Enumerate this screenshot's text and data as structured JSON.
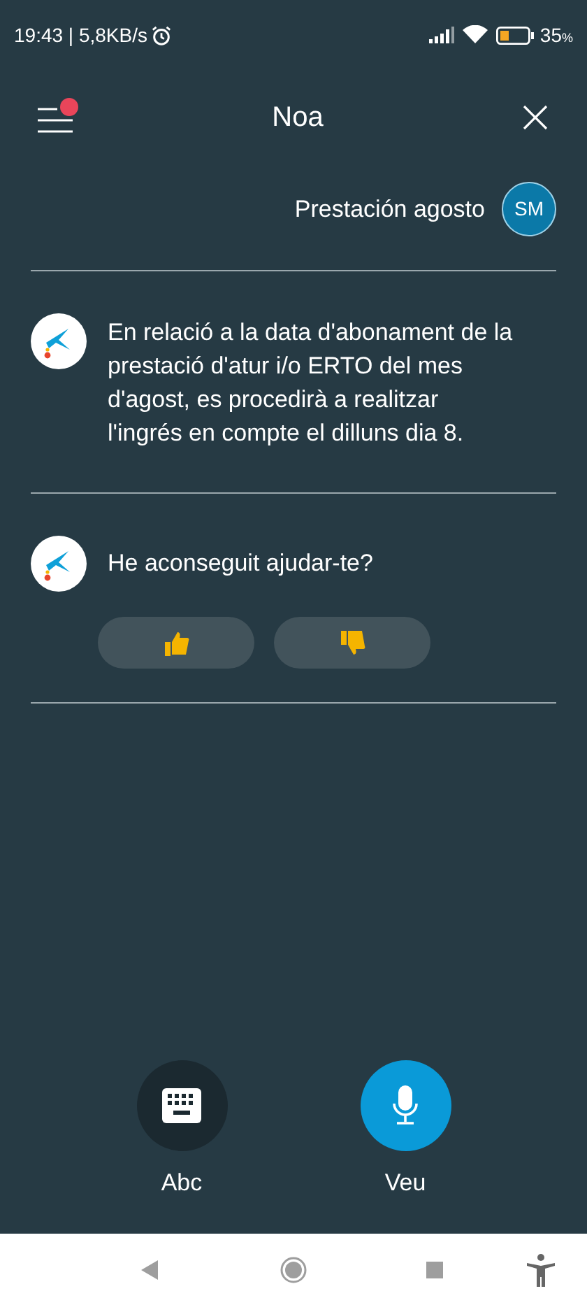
{
  "status_bar": {
    "text": "19:43 | 5,8KB/s",
    "battery": "35",
    "battery_unit": "%"
  },
  "header": {
    "title": "Noa",
    "menu_badge": true
  },
  "messages": [
    {
      "kind": "user",
      "text": "Prestación agosto",
      "avatar": "SM"
    },
    {
      "kind": "bot",
      "text": "En relació a la data d'abonament de la prestació d'atur i/o ERTO del mes d'agost, es procedirà a realitzar l'ingrés en compte el dilluns dia 8."
    },
    {
      "kind": "feedback",
      "text": "He aconseguit ajudar-te?"
    }
  ],
  "input_modes": [
    {
      "kind": "keyboard",
      "label": "Abc",
      "selected": false
    },
    {
      "kind": "voice",
      "label": "Veu",
      "selected": true
    }
  ]
}
